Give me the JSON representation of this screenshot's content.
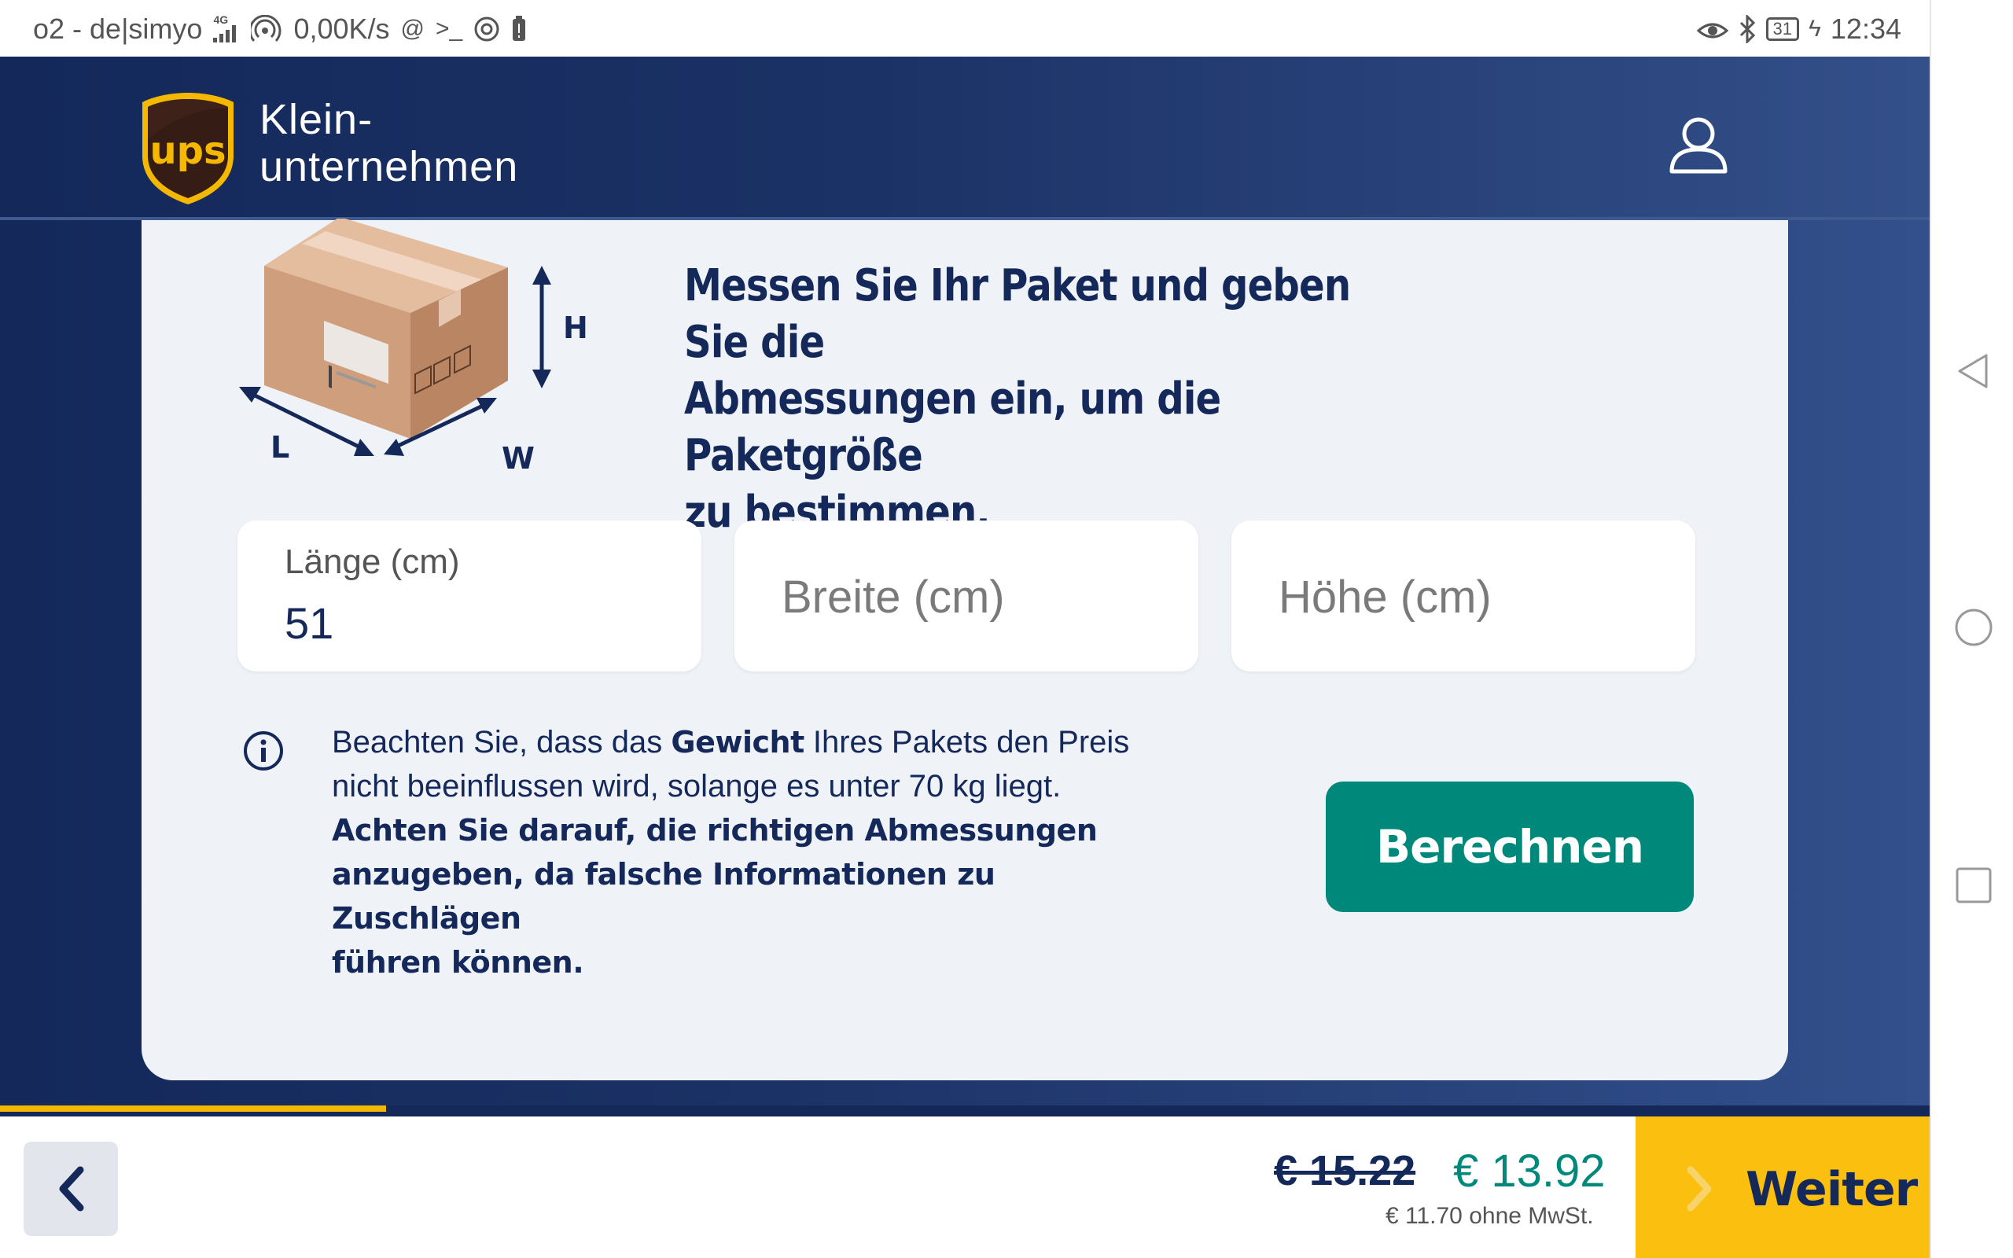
{
  "statusbar": {
    "carrier": "o2 - de|simyo",
    "network_type": "4G",
    "speed": "0,00K/s",
    "battery": "31",
    "time": "12:34"
  },
  "header": {
    "logo_text": "ups",
    "brand_line1": "Klein-",
    "brand_line2": "unternehmen"
  },
  "illustration": {
    "label_h": "H",
    "label_l": "L",
    "label_w": "W"
  },
  "headline": {
    "line1": "Messen Sie Ihr Paket und geben Sie die",
    "line2": "Abmessungen ein, um die Paketgröße",
    "line3": "zu bestimmen."
  },
  "fields": {
    "length": {
      "label": "Länge (cm)",
      "value": "51"
    },
    "width": {
      "placeholder": "Breite (cm)"
    },
    "height": {
      "placeholder": "Höhe (cm)"
    }
  },
  "info": {
    "t1": "Beachten Sie, dass das ",
    "t1_bold": "Gewicht",
    "t2": " Ihres Pakets den Preis",
    "line2": "nicht beeinflussen wird, solange es unter 70 kg liegt.",
    "bold_line1": "Achten Sie darauf, die richtigen Abmessungen",
    "bold_line2": "anzugeben, da falsche Informationen zu Zuschlägen",
    "bold_line3": "führen können."
  },
  "calc_button": "Berechnen",
  "progress": {
    "fraction": 0.2
  },
  "footer": {
    "old_price": "€ 15.22",
    "new_price": "€ 13.92",
    "net_price": "€ 11.70 ohne MwSt.",
    "next_label": "Weiter"
  },
  "colors": {
    "navy": "#14285a",
    "teal": "#00897b",
    "yellow": "#fbbf0f",
    "card_bg": "#eff2f7"
  },
  "icons": [
    "cat-eye-icon",
    "bluetooth-icon",
    "user-icon",
    "info-icon",
    "back-chevron-icon",
    "next-chevron-icon",
    "nav-back-icon",
    "nav-home-icon",
    "nav-recents-icon"
  ]
}
